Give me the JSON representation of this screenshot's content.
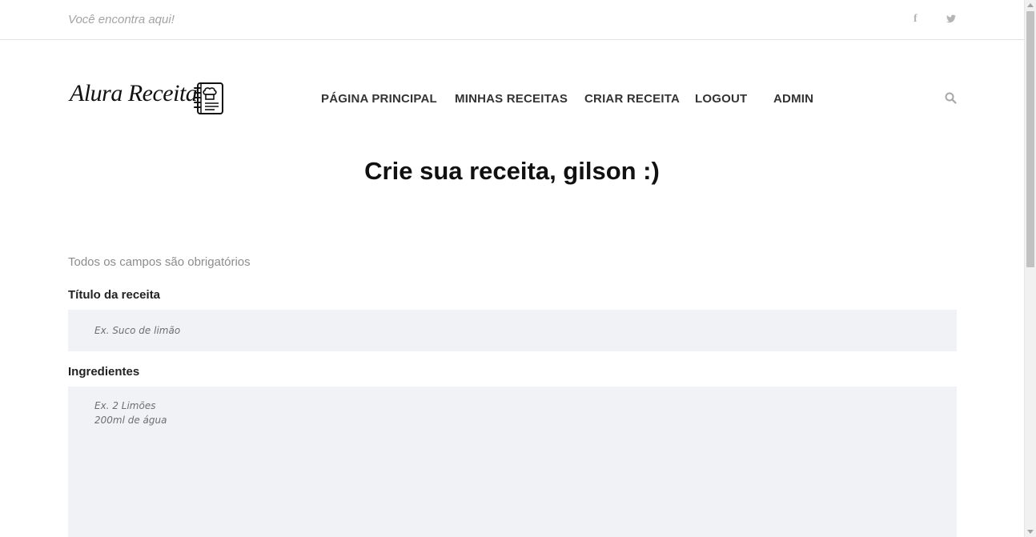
{
  "topbar": {
    "tagline": "Você encontra aqui!",
    "social": [
      {
        "icon": "facebook-icon",
        "glyph": "f"
      },
      {
        "icon": "twitter-icon"
      }
    ]
  },
  "header": {
    "logo_text": "Alura Receita",
    "logo_icon": "recipe-book-icon",
    "nav": [
      {
        "label": "PÁGINA PRINCIPAL"
      },
      {
        "label": "MINHAS RECEITAS"
      },
      {
        "label": "CRIAR RECEITA"
      },
      {
        "label": "LOGOUT"
      },
      {
        "label": "ADMIN"
      }
    ],
    "search_icon": "search-icon"
  },
  "main": {
    "title": "Crie sua receita, gilson :)",
    "hint": "Todos os campos são obrigatórios",
    "fields": {
      "title_label": "Título da receita",
      "title_placeholder": "Ex. Suco de limão",
      "title_value": "",
      "ingredients_label": "Ingredientes",
      "ingredients_placeholder": "Ex. 2 Limões\n200ml de água",
      "ingredients_value": ""
    }
  },
  "colors": {
    "field_background": "#f1f2f6",
    "muted_text": "#8c8c8c",
    "nav_text": "#333333"
  }
}
